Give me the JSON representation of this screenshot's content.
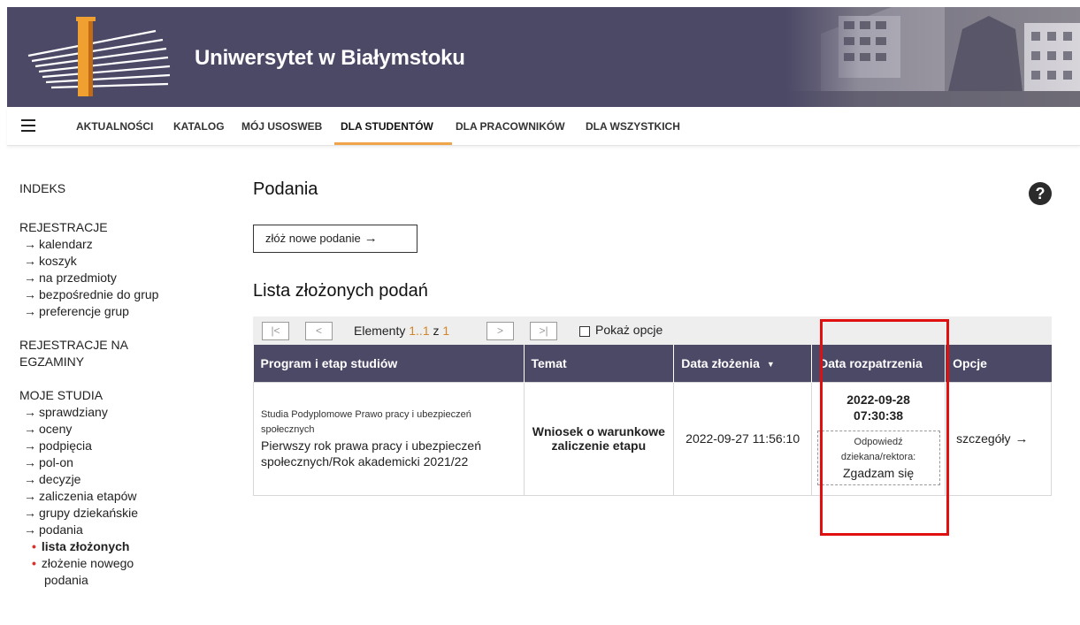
{
  "header": {
    "title": "Uniwersytet w Białymstoku",
    "logo_icon": "university-logo-icon",
    "background_color": "#4c4967"
  },
  "topnav": {
    "items": [
      {
        "label": "AKTUALNOŚCI"
      },
      {
        "label": "KATALOG"
      },
      {
        "label": "MÓJ USOSWEB"
      },
      {
        "label": "DLA STUDENTÓW",
        "active": true
      },
      {
        "label": "DLA PRACOWNIKÓW"
      },
      {
        "label": "DLA WSZYSTKICH"
      }
    ],
    "active_underline_color": "#f0a44a"
  },
  "sidebar": {
    "indeks": "INDEKS",
    "rejestracje": {
      "head": "REJESTRACJE",
      "items": [
        "kalendarz",
        "koszyk",
        "na przedmioty",
        "bezpośrednie do grup",
        "preferencje grup"
      ]
    },
    "rejestracje_egz": {
      "head_line1": "REJESTRACJE NA",
      "head_line2": "EGZAMINY"
    },
    "moje_studia": {
      "head": "MOJE STUDIA",
      "items": [
        "sprawdziany",
        "oceny",
        "podpięcia",
        "pol-on",
        "decyzje",
        "zaliczenia etapów",
        "grupy dziekańskie",
        "podania"
      ],
      "sub_items": [
        {
          "label": "lista złożonych",
          "active": true
        },
        {
          "label_line1": "złożenie nowego",
          "label_line2": "podania"
        }
      ]
    },
    "arrow": "→",
    "bullet": "•"
  },
  "main": {
    "title": "Podania",
    "new_button": {
      "label": "złóż nowe podanie",
      "arrow": "→"
    },
    "list_title": "Lista złożonych podań",
    "toolbar": {
      "first": "|<",
      "prev": "<",
      "next": ">",
      "last": ">|",
      "elements_prefix": "Elementy",
      "range": "1..1",
      "of": "z",
      "total": "1",
      "show_options": "Pokaż opcje"
    },
    "table": {
      "headers": [
        "Program i etap studiów",
        "Temat",
        "Data złożenia",
        "Data rozpatrzenia",
        "Opcje"
      ],
      "sort_indicator": "▼",
      "rows": [
        {
          "program_line1": "Studia Podyplomowe Prawo pracy i ubezpieczeń",
          "program_line2": "społecznych",
          "stage_line1": "Pierwszy rok prawa pracy i ubezpieczeń",
          "stage_line2": "społecznych/Rok akademicki 2021/22",
          "topic_line1": "Wniosek o warunkowe",
          "topic_line2": "zaliczenie etapu",
          "submitted": "2022-09-27 11:56:10",
          "decision_date": "2022-09-28",
          "decision_time": "07:30:38",
          "answer_label_line1": "Odpowiedź",
          "answer_label_line2": "dziekana/rektora:",
          "answer_value": "Zgadzam się",
          "details": "szczegóły",
          "details_arrow": "→"
        }
      ]
    },
    "help": "?"
  },
  "colors": {
    "accent": "#d2862a",
    "highlight": "#e01010",
    "table_header": "#4c4967"
  }
}
